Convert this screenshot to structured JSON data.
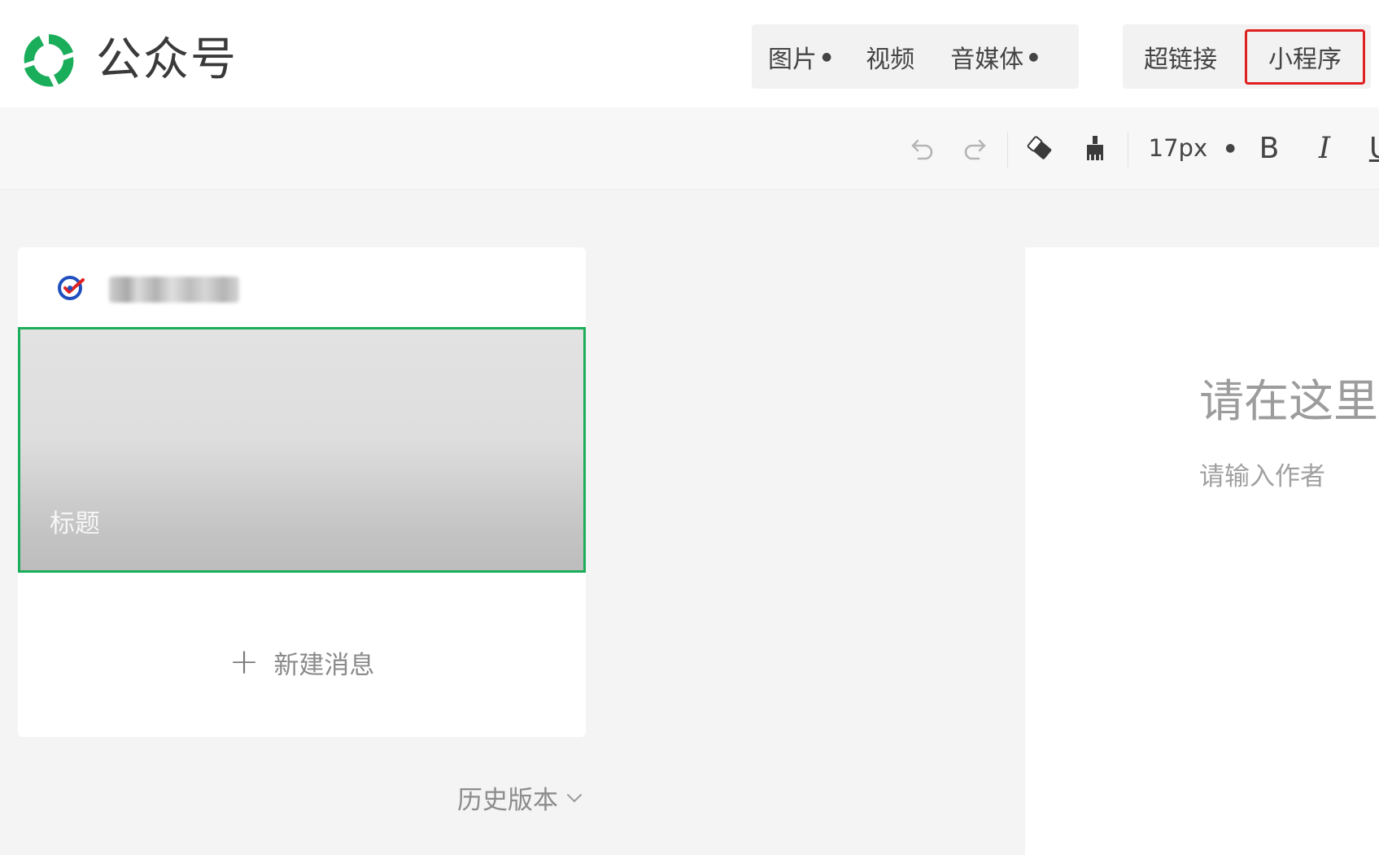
{
  "brand": {
    "name": "公众号",
    "accent": "#1aad5a"
  },
  "insert_menu": {
    "group1": [
      {
        "label": "图片",
        "has_dropdown": true
      },
      {
        "label": "视频",
        "has_dropdown": false
      },
      {
        "label": "音媒体",
        "has_dropdown": true
      }
    ],
    "group2": [
      {
        "label": "超链接"
      },
      {
        "label": "小程序",
        "highlighted": true,
        "highlight_color": "#e02020"
      }
    ]
  },
  "toolbar": {
    "undo_icon": "undo-icon",
    "redo_icon": "redo-icon",
    "eraser_icon": "eraser-icon",
    "format_painter_icon": "format-painter-icon",
    "font_size": "17px",
    "bold": "B",
    "italic": "I",
    "underline": "U"
  },
  "article_list": {
    "cover_title": "标题",
    "new_message": "新建消息",
    "history": "历史版本"
  },
  "editor": {
    "title_placeholder": "请在这里输",
    "author_placeholder": "请输入作者"
  }
}
